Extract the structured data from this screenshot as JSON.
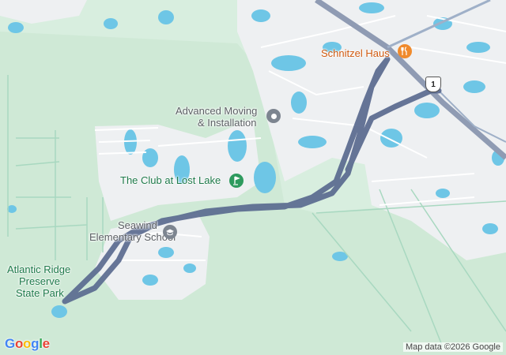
{
  "map": {
    "labels": {
      "schnitzel_haus": "Schnitzel Haus",
      "advanced_moving_1": "Advanced Moving",
      "advanced_moving_2": "& Installation",
      "club_lost_lake": "The Club at Lost Lake",
      "seawind_1": "Seawind",
      "seawind_2": "Elementary School",
      "atlantic_1": "Atlantic Ridge",
      "atlantic_2": "Preserve",
      "atlantic_3": "State Park"
    },
    "route_shield": "1",
    "icons": {
      "restaurant": "fork-knife-icon",
      "generic_poi": "place-dot-icon",
      "golf": "golf-icon",
      "school": "school-cap-icon"
    },
    "colors": {
      "land": "#d8eedf",
      "urban": "#eef0f2",
      "water": "#6ec6e6",
      "park": "#bfe3c8",
      "route": "#5a6a8f",
      "highway": "#8f9bb3",
      "logo_blue": "#4285F4",
      "logo_red": "#EA4335",
      "logo_yellow": "#FBBC05",
      "logo_green": "#34A853"
    }
  },
  "branding": {
    "logo": {
      "G": "G",
      "o1": "o",
      "o2": "o",
      "g": "g",
      "l": "l",
      "e": "e"
    }
  },
  "attribution": "Map data ©2026 Google"
}
